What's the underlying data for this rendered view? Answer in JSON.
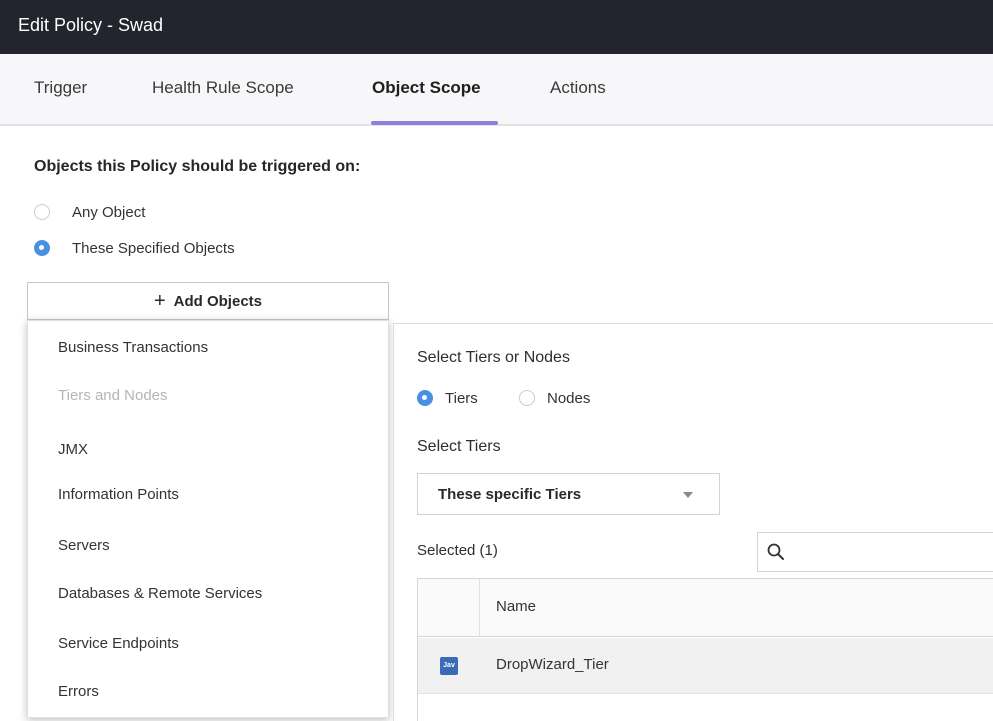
{
  "window": {
    "title": "Edit Policy - Swad"
  },
  "tabs": [
    {
      "label": "Trigger"
    },
    {
      "label": "Health Rule Scope"
    },
    {
      "label": "Object Scope",
      "active": true
    },
    {
      "label": "Actions"
    }
  ],
  "scope": {
    "heading": "Objects this Policy should be triggered on:",
    "options": [
      {
        "label": "Any Object",
        "checked": false
      },
      {
        "label": "These Specified Objects",
        "checked": true
      }
    ],
    "add_button_label": "Add Objects"
  },
  "dropdown": {
    "items": [
      {
        "label": "Business Transactions",
        "disabled": false
      },
      {
        "label": "Tiers and Nodes",
        "disabled": true
      },
      {
        "label": "JMX",
        "disabled": false
      },
      {
        "label": "Information Points",
        "disabled": false
      },
      {
        "label": "Servers",
        "disabled": false
      },
      {
        "label": "Databases & Remote Services",
        "disabled": false
      },
      {
        "label": "Service Endpoints",
        "disabled": false
      },
      {
        "label": "Errors",
        "disabled": false
      }
    ]
  },
  "tiers_panel": {
    "select_label": "Select Tiers or Nodes",
    "radio_tiers": "Tiers",
    "radio_nodes": "Nodes",
    "select_tiers_label": "Select Tiers",
    "select_value": "These specific Tiers",
    "selected_count": "Selected (1)",
    "search_placeholder": "",
    "table": {
      "column_name": "Name",
      "rows": [
        {
          "icon": "java-tier-icon",
          "icon_text": "Jav",
          "name": "DropWizard_Tier"
        }
      ]
    }
  },
  "colors": {
    "accent": "#4a90e2",
    "tab_underline": "#8d7fe0",
    "titlebar": "#22252d"
  }
}
